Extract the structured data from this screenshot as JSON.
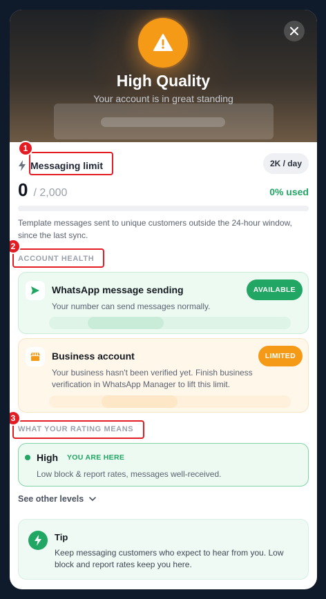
{
  "hero": {
    "title": "High Quality",
    "subtitle": "Your account is in great standing"
  },
  "annotations": [
    "1",
    "2",
    "3"
  ],
  "messaging_limit": {
    "label": "Messaging limit",
    "rate_pill": "2K / day",
    "count": "0",
    "total": "/ 2,000",
    "used": "0% used",
    "progress_fraction": 0,
    "description": "Template messages sent to unique customers outside the 24-hour window, since the last sync."
  },
  "account_health": {
    "heading": "ACCOUNT HEALTH",
    "items": [
      {
        "title": "WhatsApp message sending",
        "text": "Your number can send messages normally.",
        "status": "AVAILABLE",
        "status_color": "#21a663",
        "icon": "send-icon"
      },
      {
        "title": "Business account",
        "text": "Your business hasn't been verified yet. Finish business verification in WhatsApp Manager to lift this limit.",
        "status": "LIMITED",
        "status_color": "#f59a16",
        "icon": "store-icon"
      }
    ]
  },
  "rating": {
    "heading": "WHAT YOUR RATING MEANS",
    "level": "High",
    "here_label": "YOU ARE HERE",
    "text": "Low block & report rates, messages well-received.",
    "see_other": "See other levels"
  },
  "tip": {
    "title": "Tip",
    "text": "Keep messaging customers who expect to hear from you. Low block and report rates keep you here."
  },
  "colors": {
    "accent_green": "#21a663",
    "warning_orange": "#f59a16",
    "annotation_red": "#e31b23"
  }
}
